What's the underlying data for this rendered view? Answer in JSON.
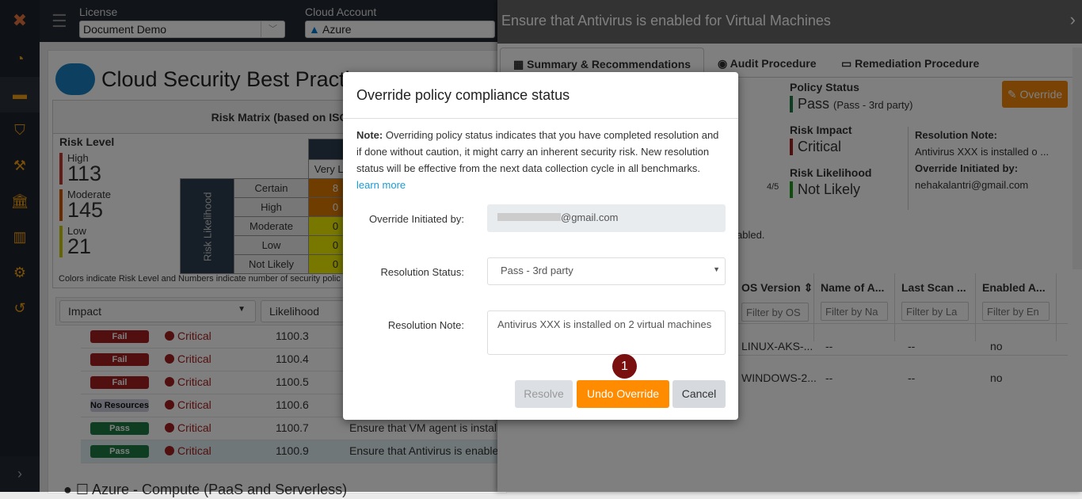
{
  "sidebar": {
    "items": [
      "dashboard",
      "briefcase",
      "shield",
      "gavel",
      "bank",
      "bar-chart",
      "gear",
      "history"
    ],
    "active": 1,
    "expand_icon": "chevron-right"
  },
  "topbar": {
    "license_label": "License",
    "license_value": "Document Demo",
    "account_label": "Cloud Account",
    "account_value": "Azure"
  },
  "page": {
    "title": "Cloud Security Best Practices"
  },
  "risk_matrix": {
    "title": "Risk Matrix (based on ISO",
    "risk_level_label": "Risk Level",
    "levels": [
      {
        "label": "High",
        "count": "113",
        "color": "#c0392b"
      },
      {
        "label": "Moderate",
        "count": "145",
        "color": "#d35400"
      },
      {
        "label": "Low",
        "count": "21",
        "color": "#c9c900"
      }
    ],
    "likelihood_axis": "Risk Likelihood",
    "column_header": "Very Low",
    "rows": [
      {
        "label": "Certain",
        "value": "8"
      },
      {
        "label": "High",
        "value": "0"
      },
      {
        "label": "Moderate",
        "value": "0"
      },
      {
        "label": "Low",
        "value": "0"
      },
      {
        "label": "Not Likely",
        "value": "0"
      }
    ],
    "note": "Colors indicate Risk Level and Numbers indicate number of security polic"
  },
  "filters": {
    "impact": "Impact",
    "likelihood": "Likelihood"
  },
  "policies": [
    {
      "status": "Fail",
      "severity": "Critical",
      "id": "1100.3",
      "desc": ""
    },
    {
      "status": "Fail",
      "severity": "Critical",
      "id": "1100.4",
      "desc": ""
    },
    {
      "status": "Fail",
      "severity": "Critical",
      "id": "1100.5",
      "desc": ""
    },
    {
      "status": "No Resources",
      "severity": "Critical",
      "id": "1100.6",
      "desc": ""
    },
    {
      "status": "Pass",
      "severity": "Critical",
      "id": "1100.7",
      "desc": "Ensure that VM agent is install"
    },
    {
      "status": "Pass",
      "severity": "Critical",
      "id": "1100.9",
      "desc": "Ensure that Antivirus is enabled"
    }
  ],
  "next_group": "Azure - Compute (PaaS and Serverless)",
  "panel": {
    "title": "Ensure that Antivirus is enabled for Virtual Machines",
    "tabs": [
      "Summary & Recommendations",
      "Audit Procedure",
      "Remediation Procedure"
    ],
    "policy_status_label": "Policy Status",
    "policy_status": "Pass",
    "policy_status_detail": "(Pass - 3rd party)",
    "risk_impact_label": "Risk Impact",
    "risk_impact": "Critical",
    "risk_likelihood_label": "Risk Likelihood",
    "risk_likelihood": "Not Likely",
    "resolution_note_label": "Resolution Note:",
    "resolution_note": "Antivirus XXX is installed o ...",
    "override_by_label": "Override Initiated by:",
    "override_by": "nehakalantri@gmail.com",
    "override_button": "Override",
    "score": "4/5",
    "fragment": "abled.",
    "table": {
      "headers": [
        "OS Version",
        "Name of A...",
        "Last Scan ...",
        "Enabled A..."
      ],
      "placeholders": [
        "Filter by OS",
        "Filter by Na",
        "Filter by La",
        "Filter by En"
      ],
      "rows": [
        [
          "LINUX-AKS-...",
          "--",
          "--",
          "no"
        ],
        [
          "WINDOWS-2...",
          "--",
          "--",
          "no"
        ]
      ]
    }
  },
  "modal": {
    "title": "Override policy compliance status",
    "note_label": "Note:",
    "note": "Overriding policy status indicates that you have completed resolution and if done without caution, it might carry an inherent security risk. New resolution status will be effective from the next data collection cycle in all benchmarks.",
    "learn_more": "learn more",
    "initiated_label": "Override Initiated by:",
    "initiated_value": "@gmail.com",
    "status_label": "Resolution Status:",
    "status_value": "Pass - 3rd party",
    "note_field_label": "Resolution Note:",
    "note_field_value": "Antivirus XXX is installed on 2 virtual machines",
    "resolve": "Resolve",
    "undo": "Undo Override",
    "cancel": "Cancel",
    "step": "1"
  },
  "colors": {
    "accent": "#f0860a",
    "fail": "#a51f1f",
    "pass": "#1e7a45",
    "step": "#7a0f0f"
  }
}
